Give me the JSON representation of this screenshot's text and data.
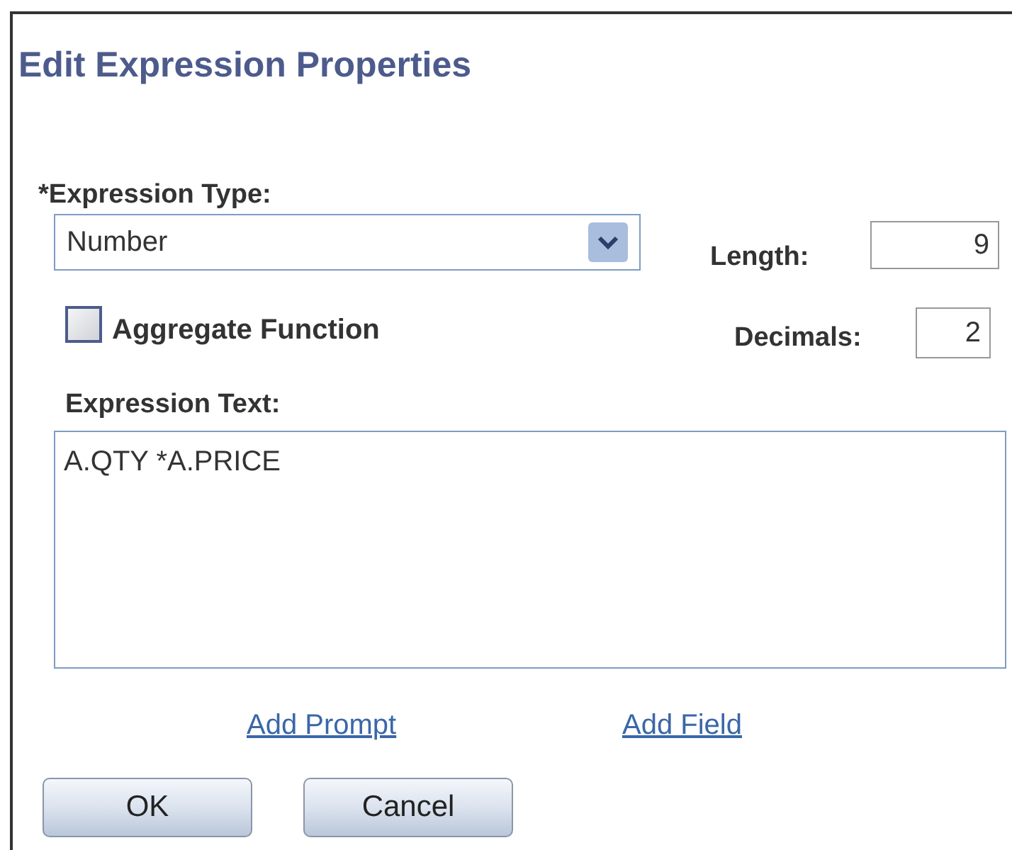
{
  "title": "Edit Expression Properties",
  "expression_type": {
    "label": "*Expression Type:",
    "value": "Number"
  },
  "length": {
    "label": "Length:",
    "value": "9"
  },
  "aggregate_function": {
    "label": "Aggregate Function",
    "checked": false
  },
  "decimals": {
    "label": "Decimals:",
    "value": "2"
  },
  "expression_text": {
    "label": "Expression Text:",
    "value": "A.QTY *A.PRICE"
  },
  "links": [
    "Add Prompt",
    "Add Field"
  ],
  "buttons": [
    "OK",
    "Cancel"
  ]
}
